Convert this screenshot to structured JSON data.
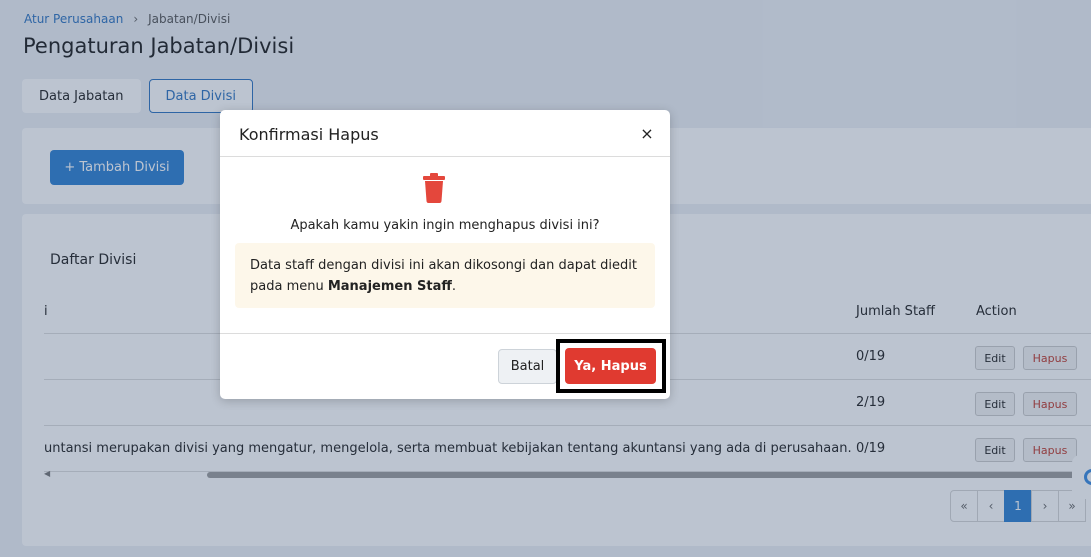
{
  "breadcrumb": {
    "parent": "Atur Perusahaan",
    "separator": "›",
    "current": "Jabatan/Divisi"
  },
  "page": {
    "title": "Pengaturan Jabatan/Divisi"
  },
  "tabs": [
    {
      "label": "Data Jabatan",
      "active": false
    },
    {
      "label": "Data Divisi",
      "active": true
    }
  ],
  "add_button": {
    "label": "+ Tambah Divisi"
  },
  "list": {
    "title": "Daftar Divisi",
    "columns": {
      "description": "i",
      "staff_count": "Jumlah Staff",
      "action": "Action"
    },
    "rows": [
      {
        "description": "",
        "staff_count": "0/19",
        "edit": "Edit",
        "delete": "Hapus"
      },
      {
        "description": "",
        "staff_count": "2/19",
        "edit": "Edit",
        "delete": "Hapus"
      },
      {
        "description": "untansi merupakan divisi yang mengatur, mengelola, serta membuat kebijakan tentang akuntansi yang ada di perusahaan.",
        "staff_count": "0/19",
        "edit": "Edit",
        "delete": "Hapus"
      }
    ]
  },
  "scrollbar": {
    "left_arrow": "◀"
  },
  "pagination": {
    "first": "«",
    "prev": "‹",
    "current": "1",
    "next": "›",
    "last": "»"
  },
  "modal": {
    "title": "Konfirmasi Hapus",
    "close": "×",
    "question": "Apakah kamu yakin ingin menghapus divisi ini?",
    "notice_text": "Data staff dengan divisi ini akan dikosongi dan dapat diedit pada menu ",
    "notice_bold": "Manajemen Staff",
    "notice_end": ".",
    "cancel_label": "Batal",
    "confirm_label": "Ya, Hapus"
  },
  "colors": {
    "primary": "#2f80d1",
    "danger": "#e03a30",
    "notice_bg": "#fdf7ea"
  }
}
